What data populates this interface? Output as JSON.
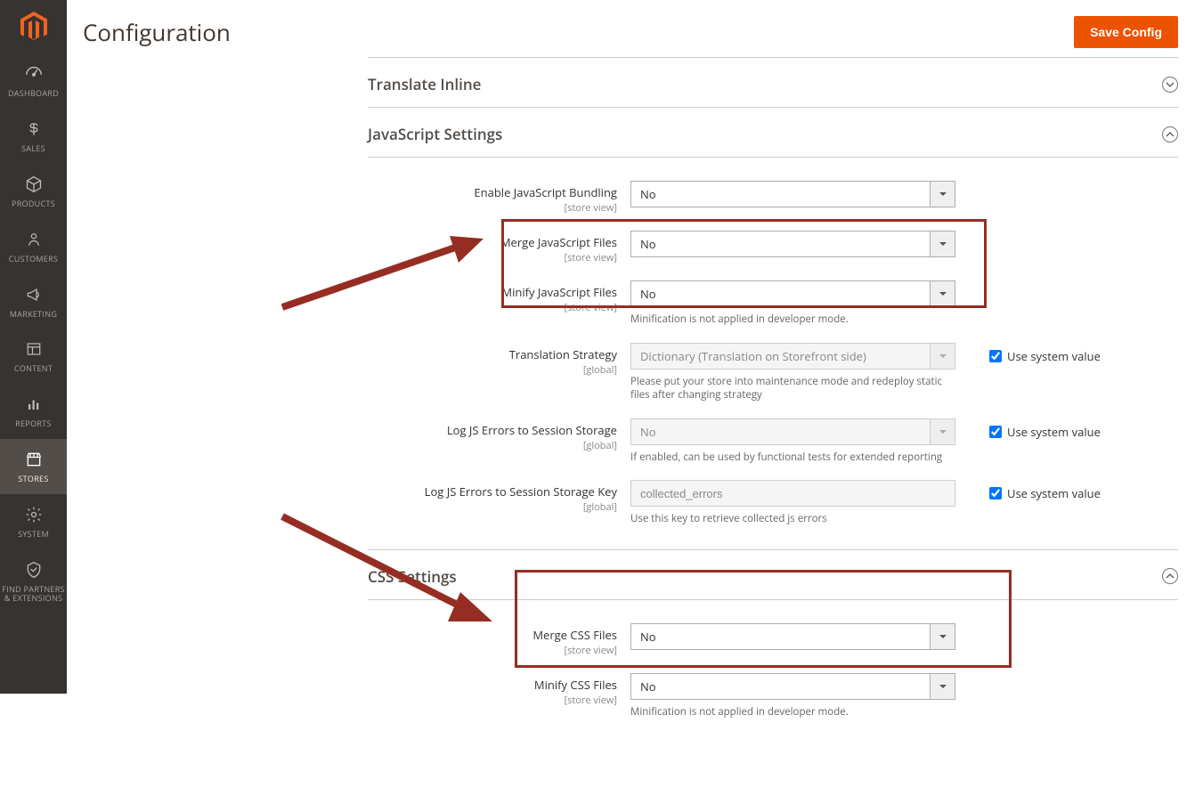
{
  "sidebar": {
    "items": [
      {
        "label": "DASHBOARD"
      },
      {
        "label": "SALES"
      },
      {
        "label": "PRODUCTS"
      },
      {
        "label": "CUSTOMERS"
      },
      {
        "label": "MARKETING"
      },
      {
        "label": "CONTENT"
      },
      {
        "label": "REPORTS"
      },
      {
        "label": "STORES"
      },
      {
        "label": "SYSTEM"
      },
      {
        "label": "FIND PARTNERS & EXTENSIONS"
      }
    ]
  },
  "header": {
    "title": "Configuration",
    "save_label": "Save Config"
  },
  "sections": {
    "translate_inline": {
      "title": "Translate Inline"
    },
    "js_settings": {
      "title": "JavaScript Settings",
      "fields": {
        "enable_bundling": {
          "label": "Enable JavaScript Bundling",
          "scope": "[store view]",
          "value": "No"
        },
        "merge_js": {
          "label": "Merge JavaScript Files",
          "scope": "[store view]",
          "value": "No"
        },
        "minify_js": {
          "label": "Minify JavaScript Files",
          "scope": "[store view]",
          "value": "No",
          "note": "Minification is not applied in developer mode."
        },
        "translation_strategy": {
          "label": "Translation Strategy",
          "scope": "[global]",
          "value": "Dictionary (Translation on Storefront side)",
          "note": "Please put your store into maintenance mode and redeploy static files after changing strategy",
          "use_system_label": "Use system value"
        },
        "log_js_errors": {
          "label": "Log JS Errors to Session Storage",
          "scope": "[global]",
          "value": "No",
          "note": "If enabled, can be used by functional tests for extended reporting",
          "use_system_label": "Use system value"
        },
        "log_js_key": {
          "label": "Log JS Errors to Session Storage Key",
          "scope": "[global]",
          "value": "collected_errors",
          "note": "Use this key to retrieve collected js errors",
          "use_system_label": "Use system value"
        }
      }
    },
    "css_settings": {
      "title": "CSS Settings",
      "fields": {
        "merge_css": {
          "label": "Merge CSS Files",
          "scope": "[store view]",
          "value": "No"
        },
        "minify_css": {
          "label": "Minify CSS Files",
          "scope": "[store view]",
          "value": "No",
          "note": "Minification is not applied in developer mode."
        }
      }
    }
  }
}
